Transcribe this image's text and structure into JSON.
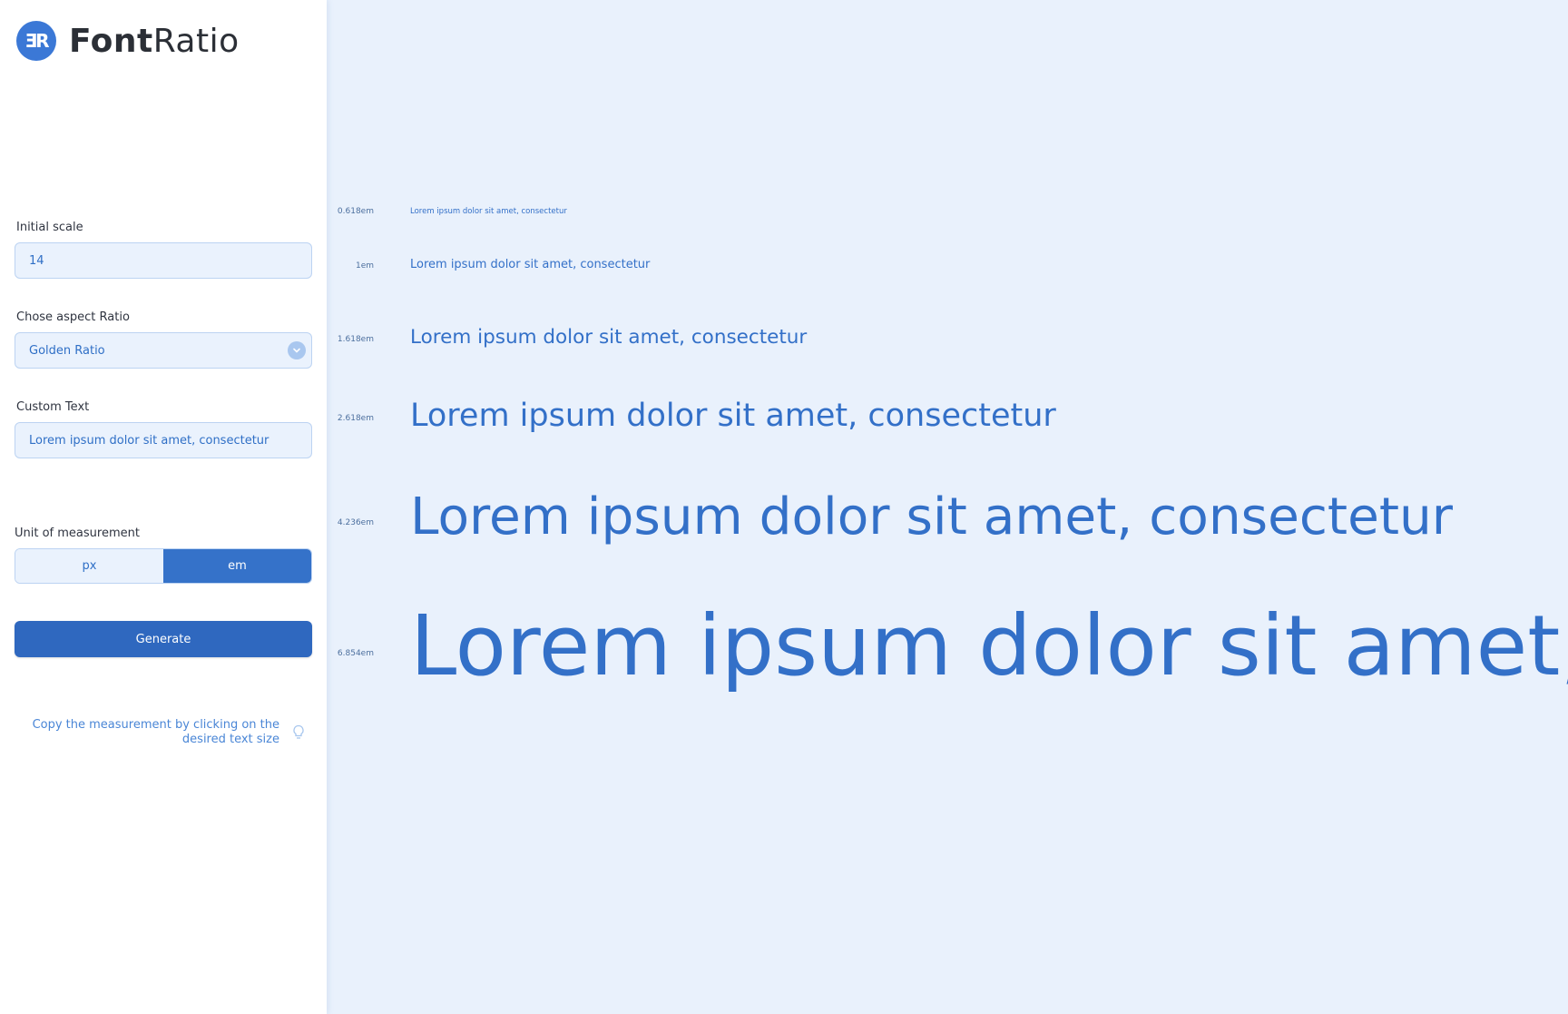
{
  "brand": {
    "logo_mark": "ƎR",
    "name_bold": "Font",
    "name_light": "Ratio"
  },
  "form": {
    "initial_scale_label": "Initial scale",
    "initial_scale_value": "14",
    "aspect_ratio_label": "Chose aspect Ratio",
    "aspect_ratio_value": "Golden Ratio",
    "custom_text_label": "Custom Text",
    "custom_text_value": "Lorem ipsum dolor sit amet, consectetur",
    "unit_label": "Unit of measurement",
    "unit_options": [
      "px",
      "em"
    ],
    "unit_selected": "em",
    "generate_label": "Generate"
  },
  "tip": {
    "text": "Copy the measurement by clicking on the desired text size",
    "icon": "lightbulb-icon"
  },
  "preview": {
    "rows": [
      {
        "size_label": "0.618em",
        "text": "Lorem ipsum dolor sit amet, consectetur"
      },
      {
        "size_label": "1em",
        "text": "Lorem ipsum dolor sit amet, consectetur"
      },
      {
        "size_label": "1.618em",
        "text": "Lorem ipsum dolor sit amet, consectetur"
      },
      {
        "size_label": "2.618em",
        "text": "Lorem ipsum dolor sit amet, consectetur"
      },
      {
        "size_label": "4.236em",
        "text": "Lorem ipsum dolor sit amet, consectetur"
      },
      {
        "size_label": "6.854em",
        "text": "Lorem ipsum dolor sit amet,"
      }
    ]
  },
  "colors": {
    "accent": "#3370c8",
    "button": "#2f68bf",
    "canvas": "#e9f1fc"
  }
}
